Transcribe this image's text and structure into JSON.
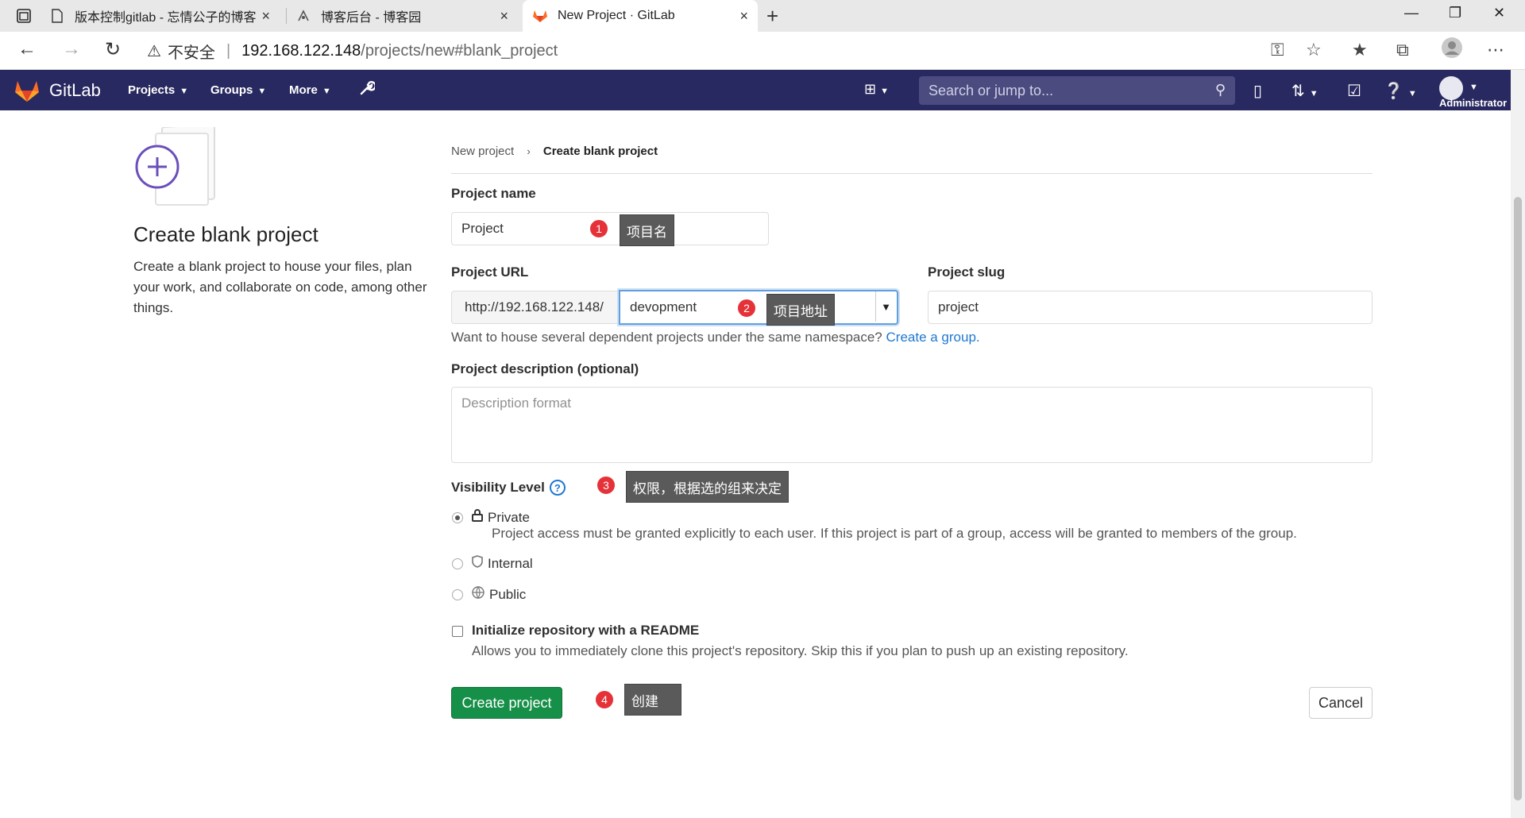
{
  "browser": {
    "tabs": [
      {
        "title": "版本控制gitlab - 忘情公子的博客",
        "close": "×"
      },
      {
        "title": "博客后台 - 博客园",
        "close": "×"
      },
      {
        "title": "New Project · GitLab",
        "close": "×"
      }
    ],
    "new_tab": "+",
    "window_controls": {
      "minimize": "—",
      "maximize": "❐",
      "close": "✕"
    },
    "address": {
      "security_label": "不安全",
      "separator": "|",
      "host": "192.168.122.148",
      "path": "/projects/new#blank_project"
    }
  },
  "gitlab_header": {
    "brand": "GitLab",
    "nav": [
      "Projects",
      "Groups",
      "More"
    ],
    "search_placeholder": "Search or jump to...",
    "user": "Administrator",
    "brand_color": "#292961"
  },
  "left_panel": {
    "title": "Create blank project",
    "description": "Create a blank project to house your files, plan your work, and collaborate on code, among other things."
  },
  "breadcrumb": {
    "parent": "New project",
    "separator": "›",
    "current": "Create blank project"
  },
  "form": {
    "project_name_label": "Project name",
    "project_name_value": "Project",
    "project_url_label": "Project URL",
    "url_prefix": "http://192.168.122.148/",
    "namespace_value": "devopment",
    "project_slug_label": "Project slug",
    "project_slug_value": "project",
    "help_text": "Want to house several dependent projects under the same namespace?",
    "help_link": "Create a group.",
    "description_label": "Project description (optional)",
    "description_placeholder": "Description format",
    "visibility_label": "Visibility Level",
    "visibility_help": "?",
    "visibility_options": [
      {
        "label": "Private",
        "icon": "lock-icon",
        "checked": true,
        "description": "Project access must be granted explicitly to each user. If this project is part of a group, access will be granted to members of the group."
      },
      {
        "label": "Internal",
        "icon": "shield-icon",
        "checked": false
      },
      {
        "label": "Public",
        "icon": "globe-icon",
        "checked": false
      }
    ],
    "readme_label": "Initialize repository with a README",
    "readme_description": "Allows you to immediately clone this project's repository. Skip this if you plan to push up an existing repository.",
    "create_button": "Create project",
    "cancel_button": "Cancel"
  },
  "annotations": [
    {
      "num": "1",
      "text": "项目名"
    },
    {
      "num": "2",
      "text": "项目地址"
    },
    {
      "num": "3",
      "text": "权限，根据选的组来决定"
    },
    {
      "num": "4",
      "text": "创建"
    }
  ],
  "colors": {
    "create_button": "#168f48",
    "link": "#1f78d1",
    "annotation_badge": "#e53238",
    "annotation_tip": "#5a5a5a"
  }
}
